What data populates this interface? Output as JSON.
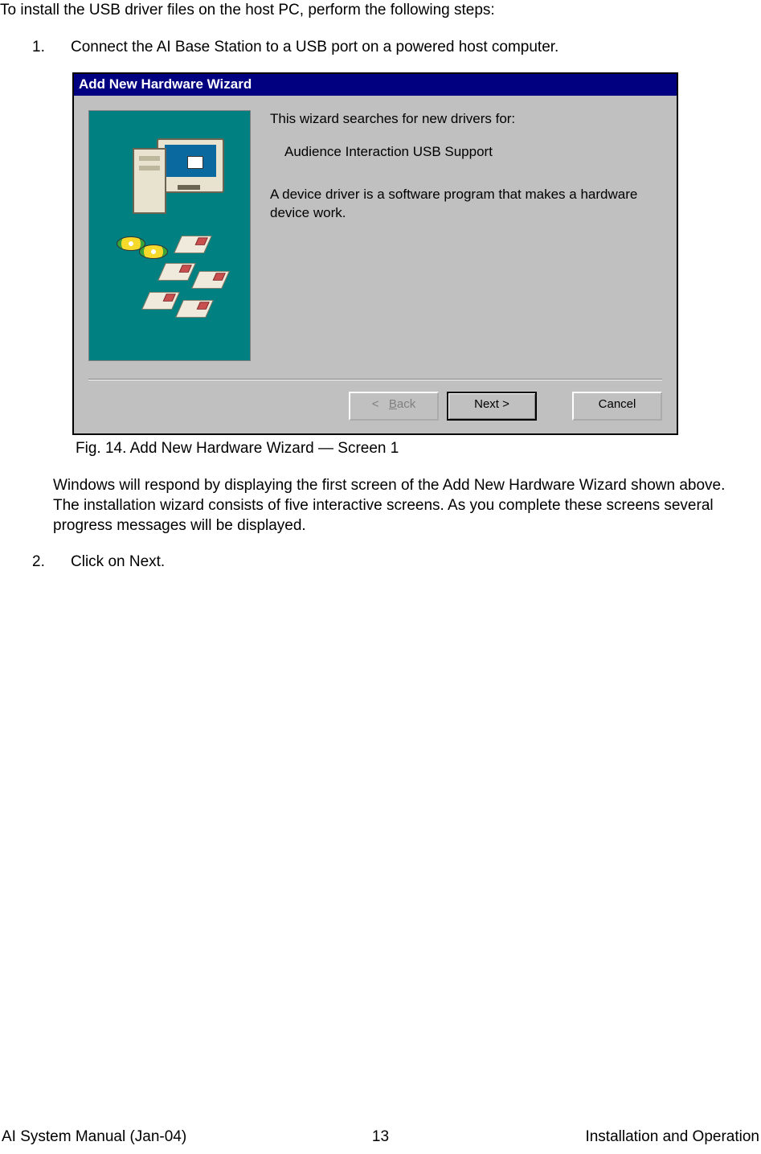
{
  "intro": "To install the USB driver files on the host PC, perform the following steps:",
  "steps": [
    {
      "num": "1.",
      "text": "Connect the AI Base Station to a USB port on a powered host computer."
    },
    {
      "num": "2.",
      "text": "Click on Next."
    }
  ],
  "wizard": {
    "title": "Add New Hardware Wizard",
    "line1": "This wizard searches for new drivers for:",
    "device": "Audience Interaction USB Support",
    "line2": "A device driver is a software program that makes a hardware device work.",
    "buttons": {
      "back_lt": "<",
      "back_label_rest": "ack",
      "back_label_u": "B",
      "next": "Next >",
      "cancel": "Cancel"
    }
  },
  "figure_caption": "Fig. 14.  Add New Hardware Wizard — Screen 1",
  "after_wizard": "Windows will respond by displaying the first screen of the Add New Hardware Wizard shown above.  The installation wizard consists of five interactive screens.  As you complete these screens several progress messages will be displayed.",
  "footer": {
    "left": "AI System Manual (Jan-04)",
    "center": "13",
    "right": "Installation and Operation"
  }
}
